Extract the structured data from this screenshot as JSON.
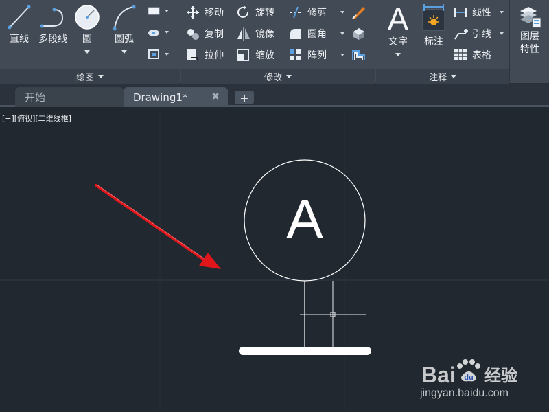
{
  "ribbon": {
    "panels": {
      "draw": {
        "footer_label": "绘图",
        "tools": {
          "line": "直线",
          "polyline": "多段线",
          "circle": "圆",
          "arc": "圆弧"
        }
      },
      "modify": {
        "footer_label": "修改",
        "tools": {
          "move": "移动",
          "rotate": "旋转",
          "trim": "修剪",
          "copy": "复制",
          "mirror": "镜像",
          "fillet": "圆角",
          "stretch": "拉伸",
          "scale": "缩放",
          "array": "阵列"
        }
      },
      "annotation": {
        "footer_label": "注释",
        "tools": {
          "text": "文字",
          "dimension": "标注",
          "linear": "线性",
          "leader": "引线",
          "table": "表格"
        }
      },
      "layers": {
        "tools": {
          "layer_properties": "图层\n特性"
        }
      }
    }
  },
  "tabs": {
    "start": "开始",
    "drawing": "Drawing1*",
    "close_glyph": "✖",
    "add_glyph": "+"
  },
  "canvas": {
    "viewport_label": "[−][俯视][二维线框]",
    "circle_letter": "A"
  },
  "watermark": {
    "brand_left": "Bai",
    "brand_right": "经验",
    "url": "jingyan.baidu.com"
  },
  "colors": {
    "ribbon_bg": "#414a55",
    "canvas_bg": "#212830",
    "arrow": "#e0161b",
    "drawing_lines": "#ffffff"
  }
}
